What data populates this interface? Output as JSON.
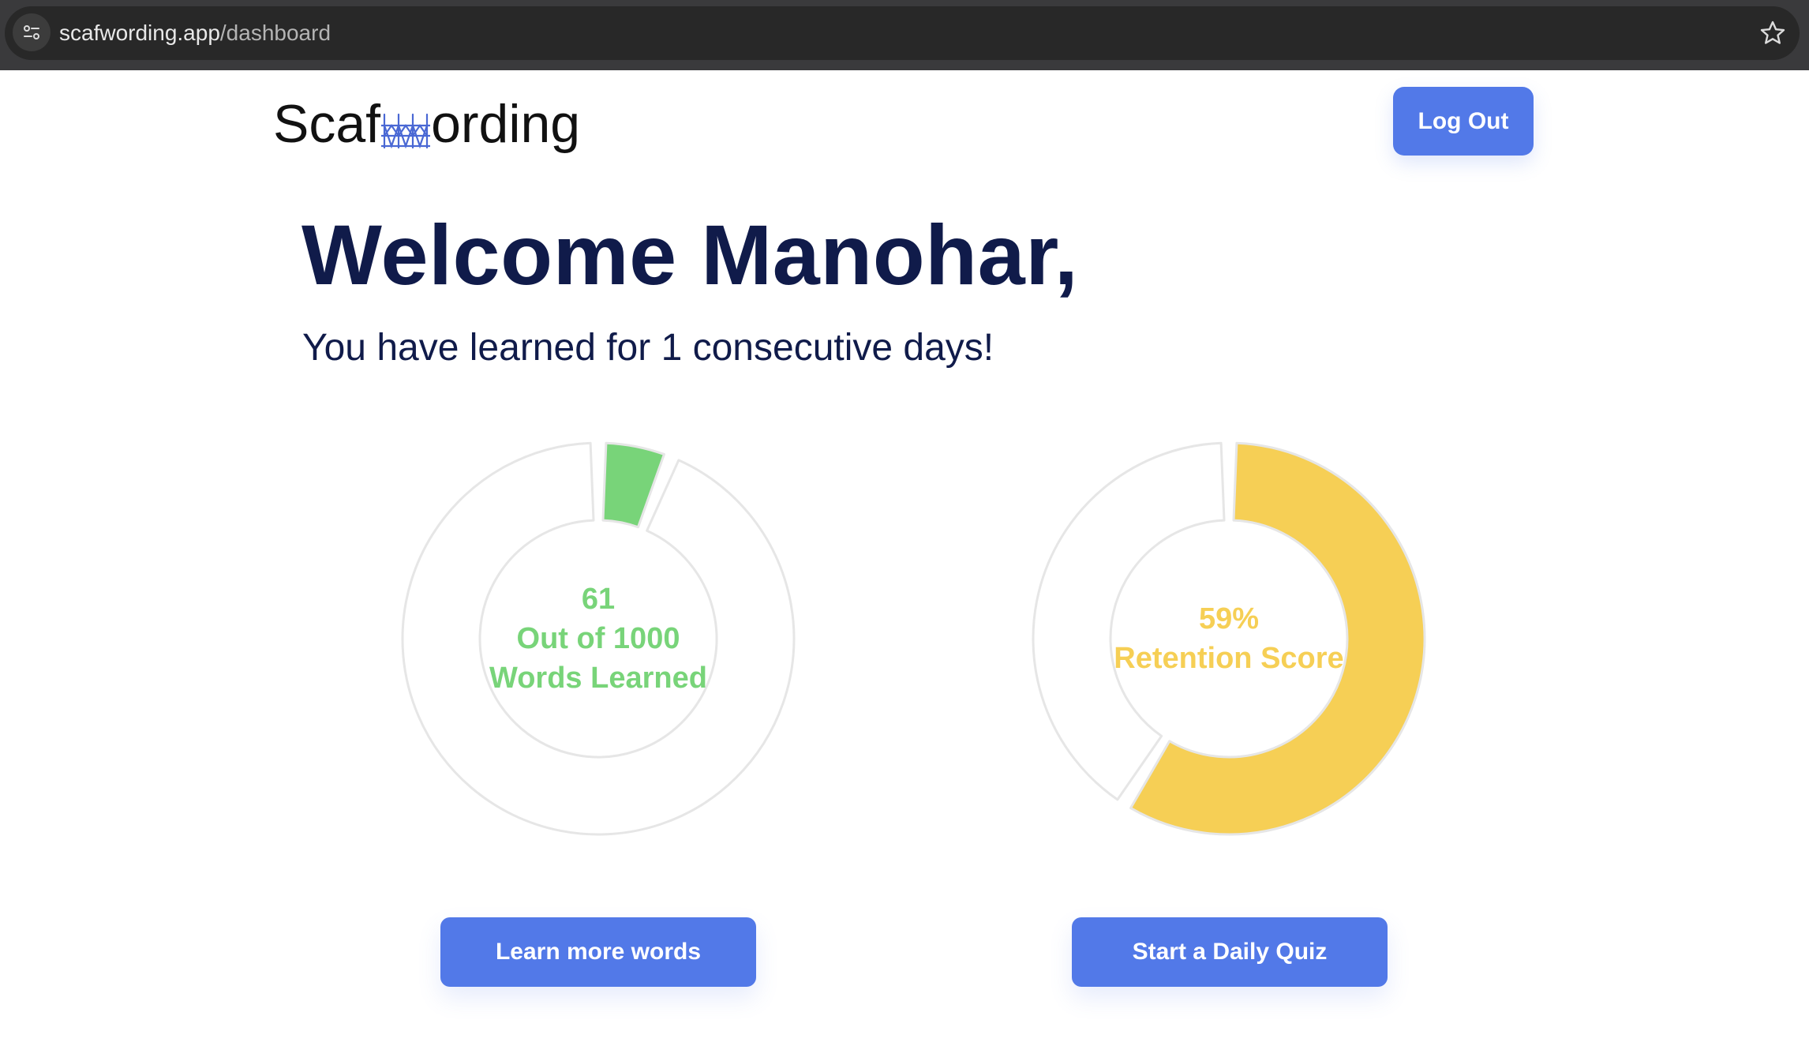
{
  "browser": {
    "url_host": "scafwording.app",
    "url_path": "/dashboard"
  },
  "header": {
    "logo_prefix": "Scaf",
    "logo_suffix": "ording",
    "logout_label": "Log Out"
  },
  "main": {
    "welcome": "Welcome Manohar,",
    "streak": "You have learned for 1 consecutive days!"
  },
  "words_card": {
    "count": "61",
    "line2": "Out of 1000",
    "line3": "Words Learned",
    "learned": 61,
    "total": 1000,
    "color": "#78d479",
    "button_label": "Learn more words"
  },
  "retention_card": {
    "score": "59%",
    "label": "Retention Score",
    "percent": 59,
    "color": "#f6cf55",
    "button_label": "Start a Daily Quiz"
  },
  "colors": {
    "primary": "#5279e8",
    "heading": "#101b4a",
    "track": "#e6e6e6"
  },
  "icons": [
    "site-info-icon",
    "bookmark-star-icon",
    "scaffold-logo-icon"
  ]
}
